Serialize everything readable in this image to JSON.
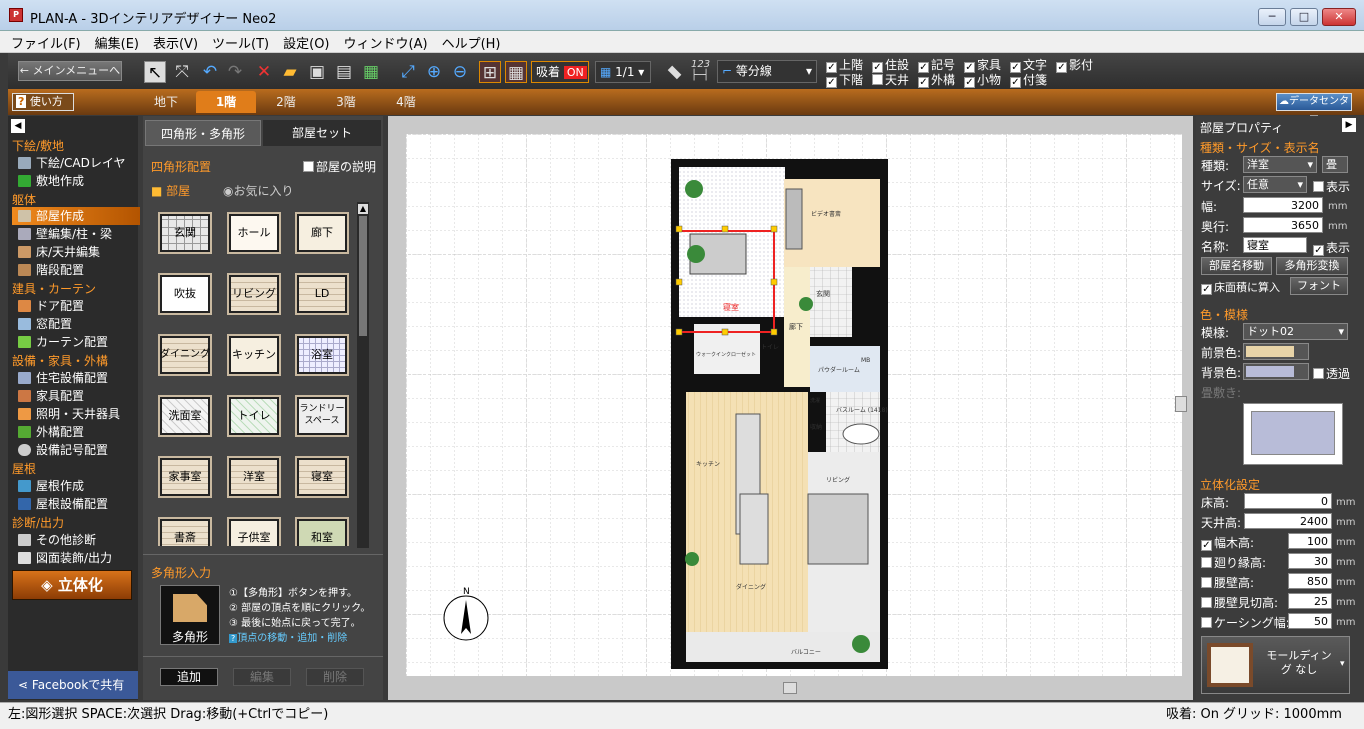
{
  "window": {
    "title": "PLAN-A - 3Dインテリアデザイナー Neo2",
    "icon_text": "P",
    "minimize": "─",
    "maximize": "□",
    "close": "✕"
  },
  "menu": [
    "ファイル(F)",
    "編集(E)",
    "表示(V)",
    "ツール(T)",
    "設定(O)",
    "ウィンドウ(A)",
    "ヘルプ(H)"
  ],
  "toolbar": {
    "main_menu": "メインメニューへ",
    "snap_label": "吸着",
    "snap_state": "ON",
    "scale": "1/1",
    "dim_label": "123",
    "divide_line": "等分線",
    "checks_top": [
      {
        "label": "上階",
        "checked": true
      },
      {
        "label": "住設",
        "checked": true
      },
      {
        "label": "記号",
        "checked": true
      },
      {
        "label": "家具",
        "checked": true
      },
      {
        "label": "文字",
        "checked": true
      },
      {
        "label": "影付",
        "checked": true
      }
    ],
    "checks_bottom": [
      {
        "label": "下階",
        "checked": true
      },
      {
        "label": "天井",
        "checked": false
      },
      {
        "label": "外構",
        "checked": true
      },
      {
        "label": "小物",
        "checked": true
      },
      {
        "label": "付箋",
        "checked": true
      }
    ]
  },
  "floorbar": {
    "help": "使い方",
    "tabs": [
      "地下",
      "1階",
      "2階",
      "3階",
      "4階"
    ],
    "active": "1階",
    "data_center": "データセンター"
  },
  "left_panel": {
    "sections": [
      {
        "title": "下絵/敷地",
        "items": [
          "下絵/CADレイヤ",
          "敷地作成"
        ]
      },
      {
        "title": "躯体",
        "items": [
          "部屋作成",
          "壁編集/柱・梁",
          "床/天井編集",
          "階段配置"
        ]
      },
      {
        "title": "建具・カーテン",
        "items": [
          "ドア配置",
          "窓配置",
          "カーテン配置"
        ]
      },
      {
        "title": "設備・家具・外構",
        "items": [
          "住宅設備配置",
          "家具配置",
          "照明・天井器具",
          "外構配置",
          "設備記号配置"
        ]
      },
      {
        "title": "屋根",
        "items": [
          "屋根作成",
          "屋根設備配置"
        ]
      },
      {
        "title": "診断/出力",
        "items": [
          "その他診断",
          "図面装飾/出力"
        ]
      }
    ],
    "selected": "部屋作成",
    "rittai": "立体化",
    "facebook": "Facebookで共有"
  },
  "room_panel": {
    "tabs": [
      "四角形・多角形",
      "部屋セット"
    ],
    "section": "四角形配置",
    "desc_check": "部屋の説明",
    "cat_room": "部屋",
    "cat_fav": "お気に入り",
    "rooms": [
      "玄関",
      "ホール",
      "廊下",
      "吹抜",
      "リビング",
      "LD",
      "ダイニング",
      "キッチン",
      "浴室",
      "洗面室",
      "トイレ",
      "ランドリースペース",
      "家事室",
      "洋室",
      "寝室",
      "書斎",
      "子供室",
      "和室"
    ],
    "poly_title": "多角形入力",
    "poly_button": "多角形",
    "steps": [
      "①【多角形】ボタンを押す。",
      "② 部屋の頂点を順にクリック。",
      "③ 最後に始点に戻って完了。"
    ],
    "poly_link": "頂点の移動・追加・削除",
    "add": "追加",
    "edit": "編集",
    "delete": "削除"
  },
  "plan_labels": {
    "bedroom": "寝室",
    "corridor": "廊下",
    "genkan": "玄関",
    "walkin": "ウォークインクローゼット",
    "toilet": "トイレ",
    "powder": "パウダールーム",
    "bath": "バスルーム (1418)",
    "kitchen": "キッチン",
    "living": "リビング",
    "dining": "ダイニング",
    "balcony": "バルコニー",
    "mb": "MB",
    "study": "ビデオ書斎",
    "washer": "洗濯",
    "storage": "収納"
  },
  "right_panel": {
    "title": "部屋プロパティ",
    "type_section": "種類・サイズ・表示名",
    "kind_label": "種類:",
    "kind_value": "洋室",
    "kind_unit": "畳",
    "size_label": "サイズ:",
    "size_value": "任意",
    "show_label": "表示",
    "width_label": "幅:",
    "width_value": "3200",
    "depth_label": "奥行:",
    "depth_value": "3650",
    "name_label": "名称:",
    "name_value": "寝室",
    "name_show": "表示",
    "move_name": "部屋名移動",
    "poly_convert": "多角形変換",
    "floor_area": "床面積に算入",
    "font": "フォント",
    "color_section": "色・模様",
    "pattern_label": "模様:",
    "pattern_value": "ドット02",
    "fg_label": "前景色:",
    "bg_label": "背景色:",
    "transparent": "透過",
    "tatami": "畳敷き:",
    "fg_color": "#e8d4a8",
    "bg_color": "#b8bcd8",
    "solid_section": "立体化設定",
    "floor_h_label": "床高:",
    "floor_h": "0",
    "ceil_h_label": "天井高:",
    "ceil_h": "2400",
    "habaki_label": "幅木高:",
    "habaki": "100",
    "mawari_label": "廻り縁高:",
    "mawari": "30",
    "koshi_label": "腰壁高:",
    "koshi": "850",
    "koshi_mikiri_label": "腰壁見切高:",
    "koshi_mikiri": "25",
    "casing_label": "ケーシング幅:",
    "casing": "50",
    "unit": "mm",
    "molding": "モールディング なし"
  },
  "status": {
    "left": "左:図形選択 SPACE:次選択 Drag:移動(+Ctrlでコピー)",
    "snap": "吸着: On",
    "grid": "グリッド: 1000mm"
  }
}
